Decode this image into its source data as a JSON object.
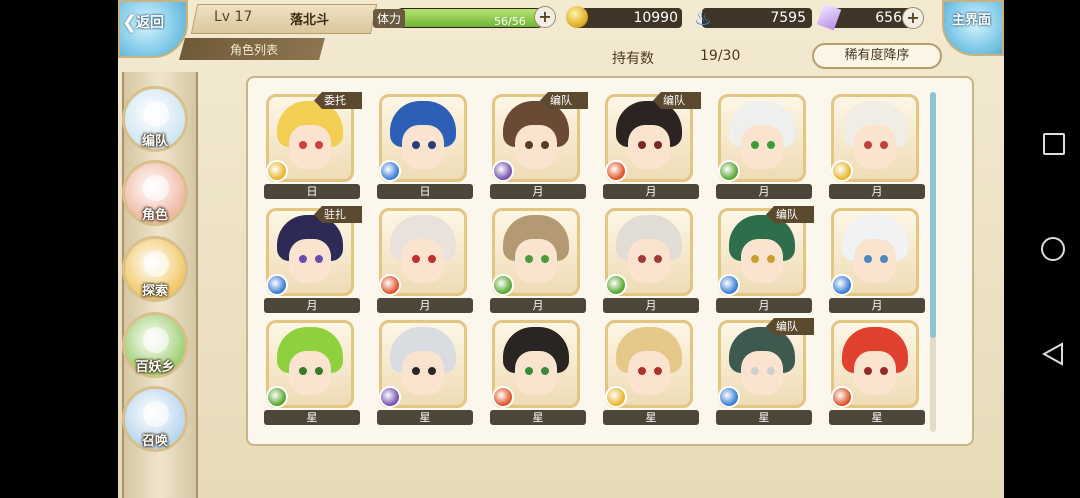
{
  "header": {
    "back_label": "返回",
    "level": "Lv 17",
    "player_name": "落北斗",
    "tab_label": "角色列表",
    "stamina_label": "体力",
    "stamina_text": "56/56",
    "stamina_fraction": 1.0,
    "gold": "10990",
    "soul_fire": "7595",
    "crystal": "656",
    "main_label": "主界面"
  },
  "toolbar": {
    "owned_label": "持有数",
    "owned_value": "19/30",
    "sort_label": "稀有度降序"
  },
  "side_menu": [
    {
      "label": "编队",
      "icon": "cat-icon",
      "color": "#cfe6f2"
    },
    {
      "label": "角色",
      "icon": "character-icon",
      "color": "#f0b9a6"
    },
    {
      "label": "探索",
      "icon": "compass-icon",
      "color": "#f2c868"
    },
    {
      "label": "百妖乡",
      "icon": "house-icon",
      "color": "#9fcf74"
    },
    {
      "label": "召唤",
      "icon": "swirl-icon",
      "color": "#b9d6ef"
    }
  ],
  "characters": [
    {
      "rank": "日",
      "status": "委托中",
      "hair": "#f2cf52",
      "eye": "#d04040",
      "attr": "sun",
      "attr_color": "#e8b52d"
    },
    {
      "rank": "日",
      "status": "",
      "hair": "#2e5fb7",
      "eye": "#2a3f7a",
      "attr": "water",
      "attr_color": "#3b7fd6"
    },
    {
      "rank": "月",
      "status": "编队中",
      "hair": "#6b4a35",
      "eye": "#5a3a2a",
      "attr": "dark",
      "attr_color": "#7a54b0"
    },
    {
      "rank": "月",
      "status": "编队中",
      "hair": "#2b2420",
      "eye": "#7a2a2a",
      "attr": "fire",
      "attr_color": "#e0552a"
    },
    {
      "rank": "月",
      "status": "",
      "hair": "#eef0ee",
      "eye": "#3c9c3c",
      "attr": "wind",
      "attr_color": "#5aa832"
    },
    {
      "rank": "月",
      "status": "",
      "hair": "#f1ece4",
      "eye": "#c04040",
      "attr": "sun",
      "attr_color": "#e8b52d"
    },
    {
      "rank": "月",
      "status": "驻扎中",
      "hair": "#2d2a55",
      "eye": "#6a4cb0",
      "attr": "water",
      "attr_color": "#3b7fd6"
    },
    {
      "rank": "月",
      "status": "",
      "hair": "#e8e2da",
      "eye": "#c03030",
      "attr": "fire",
      "attr_color": "#e0552a"
    },
    {
      "rank": "月",
      "status": "",
      "hair": "#b49a72",
      "eye": "#4a9a3a",
      "attr": "wind",
      "attr_color": "#5aa832"
    },
    {
      "rank": "月",
      "status": "",
      "hair": "#e2ddd4",
      "eye": "#a03a3a",
      "attr": "wind",
      "attr_color": "#5aa832"
    },
    {
      "rank": "月",
      "status": "编队中",
      "hair": "#2f6e4a",
      "eye": "#c8a030",
      "attr": "water",
      "attr_color": "#3b7fd6"
    },
    {
      "rank": "月",
      "status": "",
      "hair": "#f0f2f4",
      "eye": "#4a8ac0",
      "attr": "water",
      "attr_color": "#3b7fd6"
    },
    {
      "rank": "星",
      "status": "",
      "hair": "#8ed03e",
      "eye": "#3a7a2a",
      "attr": "wind",
      "attr_color": "#5aa832"
    },
    {
      "rank": "星",
      "status": "",
      "hair": "#d9dde2",
      "eye": "#2a2a2a",
      "attr": "dark",
      "attr_color": "#7a54b0"
    },
    {
      "rank": "星",
      "status": "",
      "hair": "#2a2522",
      "eye": "#3a8a3a",
      "attr": "fire",
      "attr_color": "#e0552a"
    },
    {
      "rank": "星",
      "status": "",
      "hair": "#e6c98a",
      "eye": "#b03030",
      "attr": "sun",
      "attr_color": "#e8b52d"
    },
    {
      "rank": "星",
      "status": "编队中",
      "hair": "#3e5a4e",
      "eye": "#cfcfcf",
      "attr": "water",
      "attr_color": "#3b7fd6"
    },
    {
      "rank": "星",
      "status": "",
      "hair": "#e0402e",
      "eye": "#9a2a2a",
      "attr": "fire",
      "attr_color": "#e0552a"
    }
  ],
  "android_nav": {
    "recents": "recents-square-icon",
    "home": "home-circle-icon",
    "back": "back-triangle-icon"
  }
}
